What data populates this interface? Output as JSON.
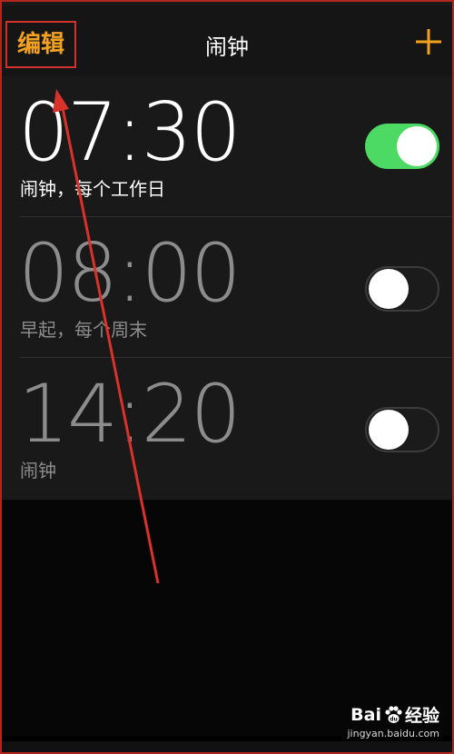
{
  "navbar": {
    "edit_label": "编辑",
    "title": "闹钟",
    "add_icon": "plus-icon"
  },
  "alarms": [
    {
      "time": "07:30",
      "label": "闹钟，每个工作日",
      "enabled": true
    },
    {
      "time": "08:00",
      "label": "早起，每个周末",
      "enabled": false
    },
    {
      "time": "14:20",
      "label": "闹钟",
      "enabled": false
    }
  ],
  "watermark": {
    "brand_left": "Bai",
    "brand_right": "经验",
    "url": "jingyan.baidu.com"
  },
  "colors": {
    "accent": "#f3a21f",
    "toggle_on": "#4cd964",
    "highlight": "#d2302a"
  }
}
